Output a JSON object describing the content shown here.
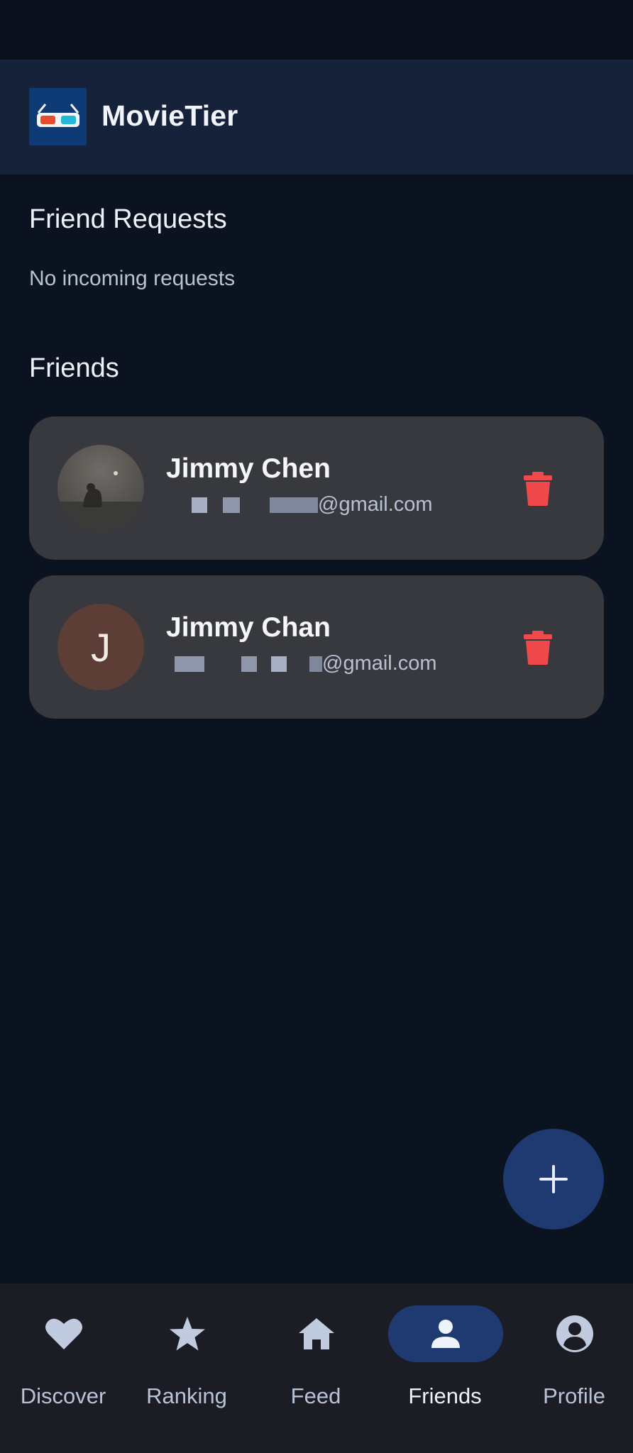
{
  "app": {
    "title": "MovieTier",
    "logo_icon": "3d-glasses-icon"
  },
  "friend_requests": {
    "title": "Friend Requests",
    "empty_text": "No incoming requests"
  },
  "friends": {
    "title": "Friends",
    "items": [
      {
        "name": "Jimmy Chen",
        "email_suffix": "@gmail.com",
        "avatar_type": "photo",
        "delete_icon": "trash-icon"
      },
      {
        "name": "Jimmy Chan",
        "email_suffix": "@gmail.com",
        "avatar_type": "letter",
        "avatar_letter": "J",
        "delete_icon": "trash-icon"
      }
    ]
  },
  "fab": {
    "icon": "plus-icon"
  },
  "bottom_nav": {
    "items": [
      {
        "label": "Discover",
        "icon": "heart-icon",
        "active": false
      },
      {
        "label": "Ranking",
        "icon": "star-icon",
        "active": false
      },
      {
        "label": "Feed",
        "icon": "home-icon",
        "active": false
      },
      {
        "label": "Friends",
        "icon": "person-icon",
        "active": true
      },
      {
        "label": "Profile",
        "icon": "account-circle-icon",
        "active": false
      }
    ]
  },
  "colors": {
    "background": "#0c1320",
    "app_bar": "#16223a",
    "card": "#38383f",
    "accent": "#1f3a70",
    "delete": "#f0494c"
  }
}
